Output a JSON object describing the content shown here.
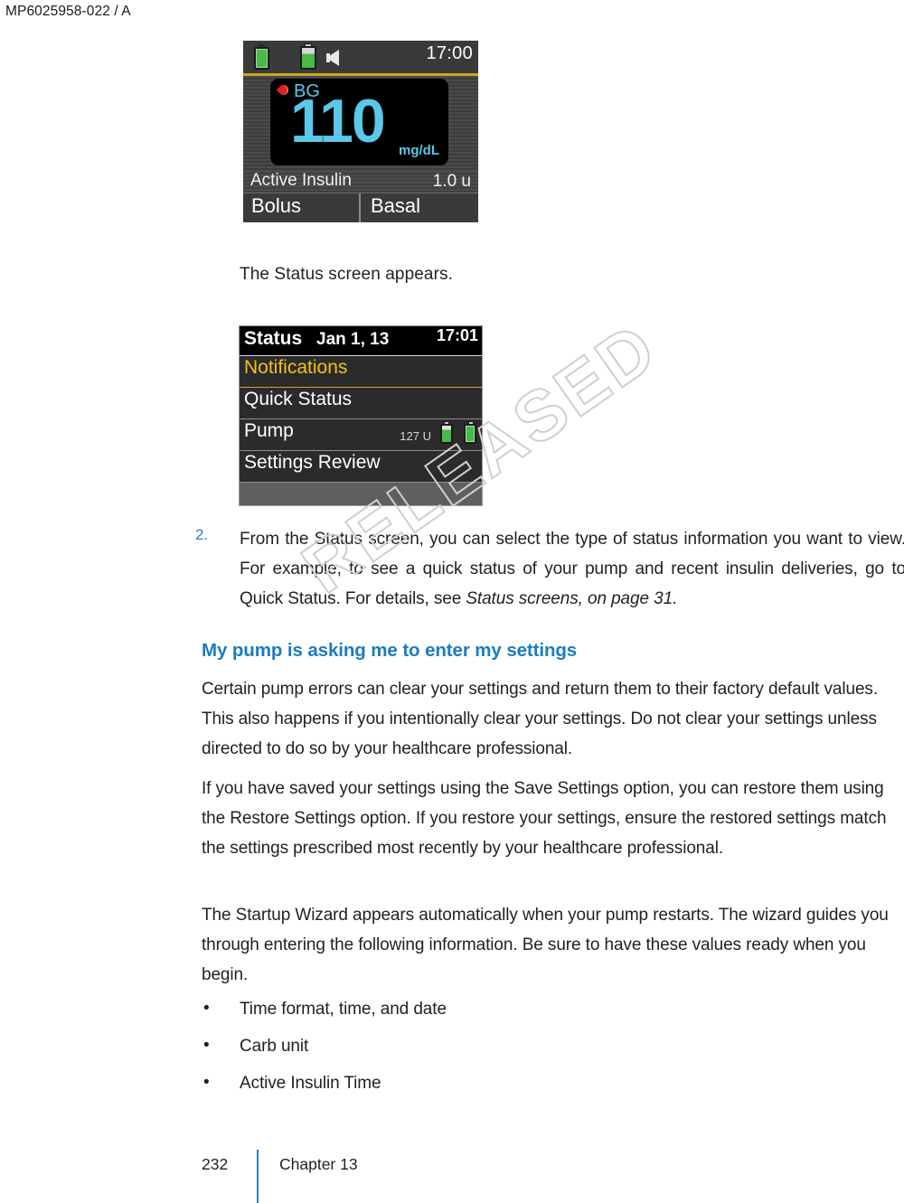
{
  "document": {
    "header_code": "MP6025958-022 / A",
    "watermark": "RELEASED",
    "footer": {
      "page_number": "232",
      "chapter": "Chapter 13"
    },
    "accent_color": "#2980c8",
    "heading_color": "#1b7cc0"
  },
  "home_screen": {
    "clock": "17:00",
    "icons": [
      "battery-icon",
      "reservoir-icon",
      "speaker-icon"
    ],
    "bg_label": "BG",
    "bg_value": "110",
    "bg_unit": "mg/dL",
    "bg_color": "#5bc8ea",
    "active_insulin_label": "Active Insulin",
    "active_insulin_value": "1.0 u",
    "tab_bolus": "Bolus",
    "tab_basal": "Basal"
  },
  "status_screen": {
    "title": "Status",
    "date": "Jan 1, 13",
    "clock": "17:01",
    "rows": [
      {
        "label": "Notifications",
        "highlighted": true
      },
      {
        "label": "Quick Status",
        "highlighted": false
      },
      {
        "label": "Pump",
        "highlighted": false,
        "units": "127 U"
      },
      {
        "label": "Settings Review",
        "highlighted": false
      }
    ]
  },
  "content": {
    "caption": "The Status screen appears.",
    "step": {
      "number": "2.",
      "text_before_italic": "From the Status screen, you can select the type of status information you want to view. For example, to see a quick status of your pump and recent insulin deliveries, go to Quick Status. For details, see ",
      "italic_ref": "Status screens, on page 31."
    },
    "section_heading": "My pump is asking me to enter my settings",
    "paragraph_1": "Certain pump errors can clear your settings and return them to their factory default values. This also happens if you intentionally clear your settings. Do not clear your settings unless directed to do so by your healthcare professional.",
    "paragraph_2": "If you have saved your settings using the Save Settings option, you can restore them using the Restore Settings option. If you restore your settings, ensure the restored settings match the settings prescribed most recently by your healthcare professional.",
    "paragraph_3": "The Startup Wizard appears automatically when your pump restarts. The wizard guides you through entering the following information. Be sure to have these values ready when you begin.",
    "bullets": [
      "Time format, time, and date",
      "Carb unit",
      "Active Insulin Time"
    ],
    "bullet_marker": "•"
  }
}
